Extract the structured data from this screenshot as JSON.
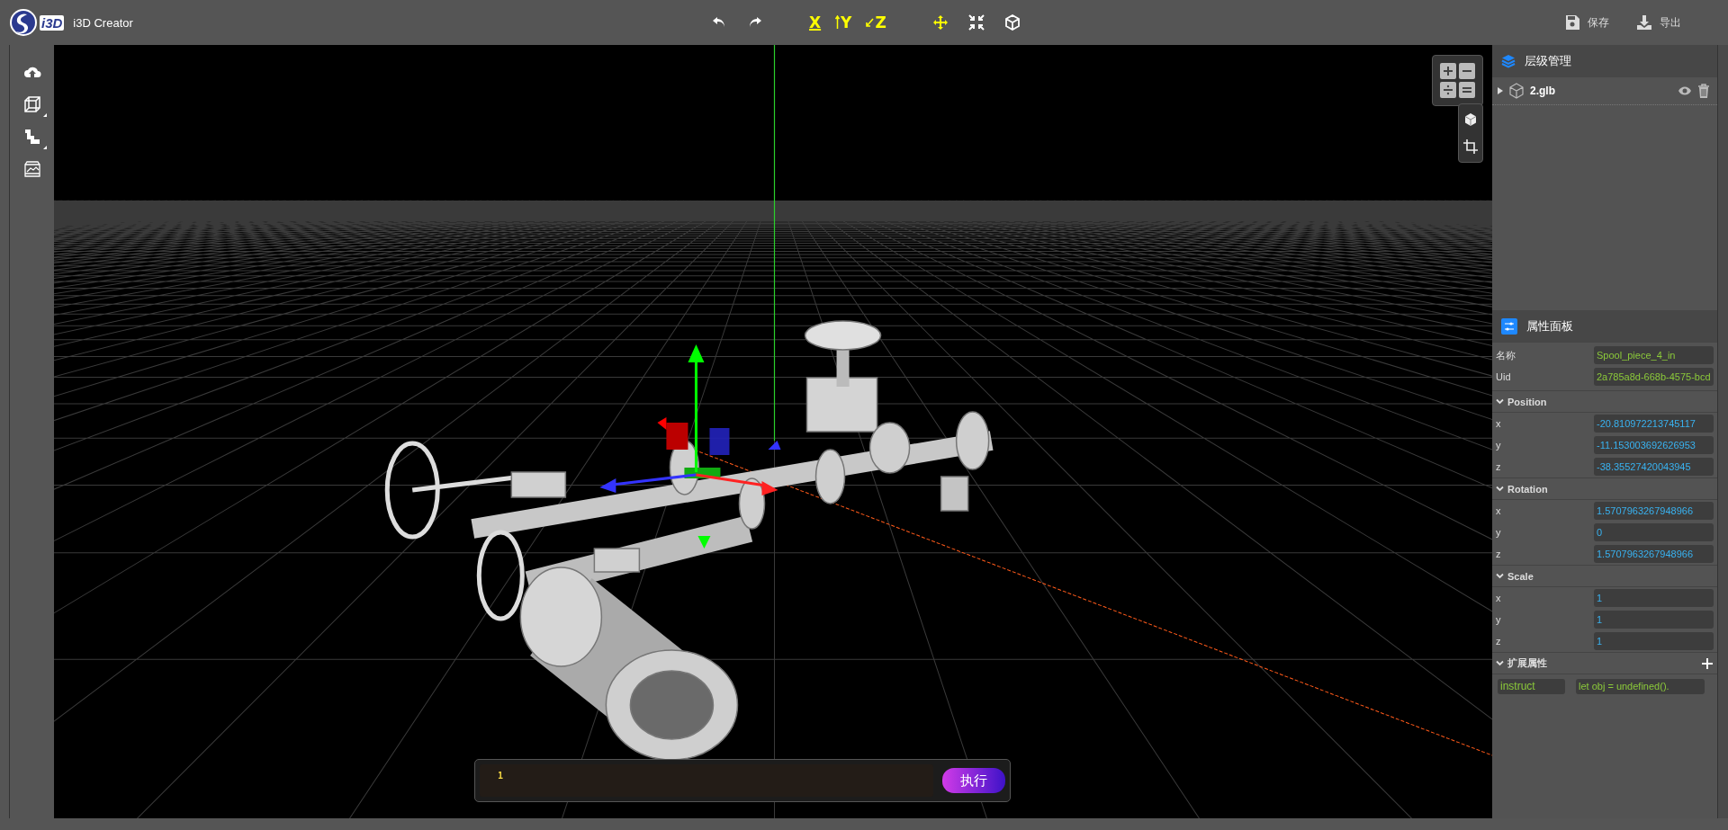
{
  "app": {
    "logo_text": "i3D",
    "title": "i3D Creator"
  },
  "axis_buttons": [
    {
      "label": "X",
      "kind": "x"
    },
    {
      "label": "Y",
      "kind": "y"
    },
    {
      "label": "Z",
      "kind": "z"
    }
  ],
  "actions": [
    {
      "label": "保存",
      "kind": "save"
    },
    {
      "label": "导出",
      "kind": "export"
    }
  ],
  "hierarchy": {
    "title": "层级管理",
    "items": [
      {
        "label": "2.glb",
        "expanded": false,
        "visible": true
      }
    ]
  },
  "properties": {
    "title": "属性面板",
    "fields": [
      {
        "label": "名称",
        "value": "Spool_piece_4_in"
      },
      {
        "label": "Uid",
        "value": "2a785a8d-668b-4575-bcd"
      }
    ],
    "sections": [
      {
        "title": "Position",
        "expanded": true,
        "rows": [
          {
            "label": "x",
            "value": "-20.810972213745117"
          },
          {
            "label": "y",
            "value": "-11.153003692626953"
          },
          {
            "label": "z",
            "value": "-38.35527420043945"
          }
        ]
      },
      {
        "title": "Rotation",
        "expanded": true,
        "rows": [
          {
            "label": "x",
            "value": "1.5707963267948966"
          },
          {
            "label": "y",
            "value": "0"
          },
          {
            "label": "z",
            "value": "1.5707963267948966"
          }
        ]
      },
      {
        "title": "Scale",
        "expanded": true,
        "rows": [
          {
            "label": "x",
            "value": "1"
          },
          {
            "label": "y",
            "value": "1"
          },
          {
            "label": "z",
            "value": "1"
          }
        ]
      }
    ],
    "extended": {
      "title": "扩展属性",
      "expanded": true,
      "items": [
        {
          "key": "instruct",
          "value": "let obj = undefined()."
        }
      ]
    }
  },
  "console": {
    "line_number": "1",
    "button": "执行"
  }
}
